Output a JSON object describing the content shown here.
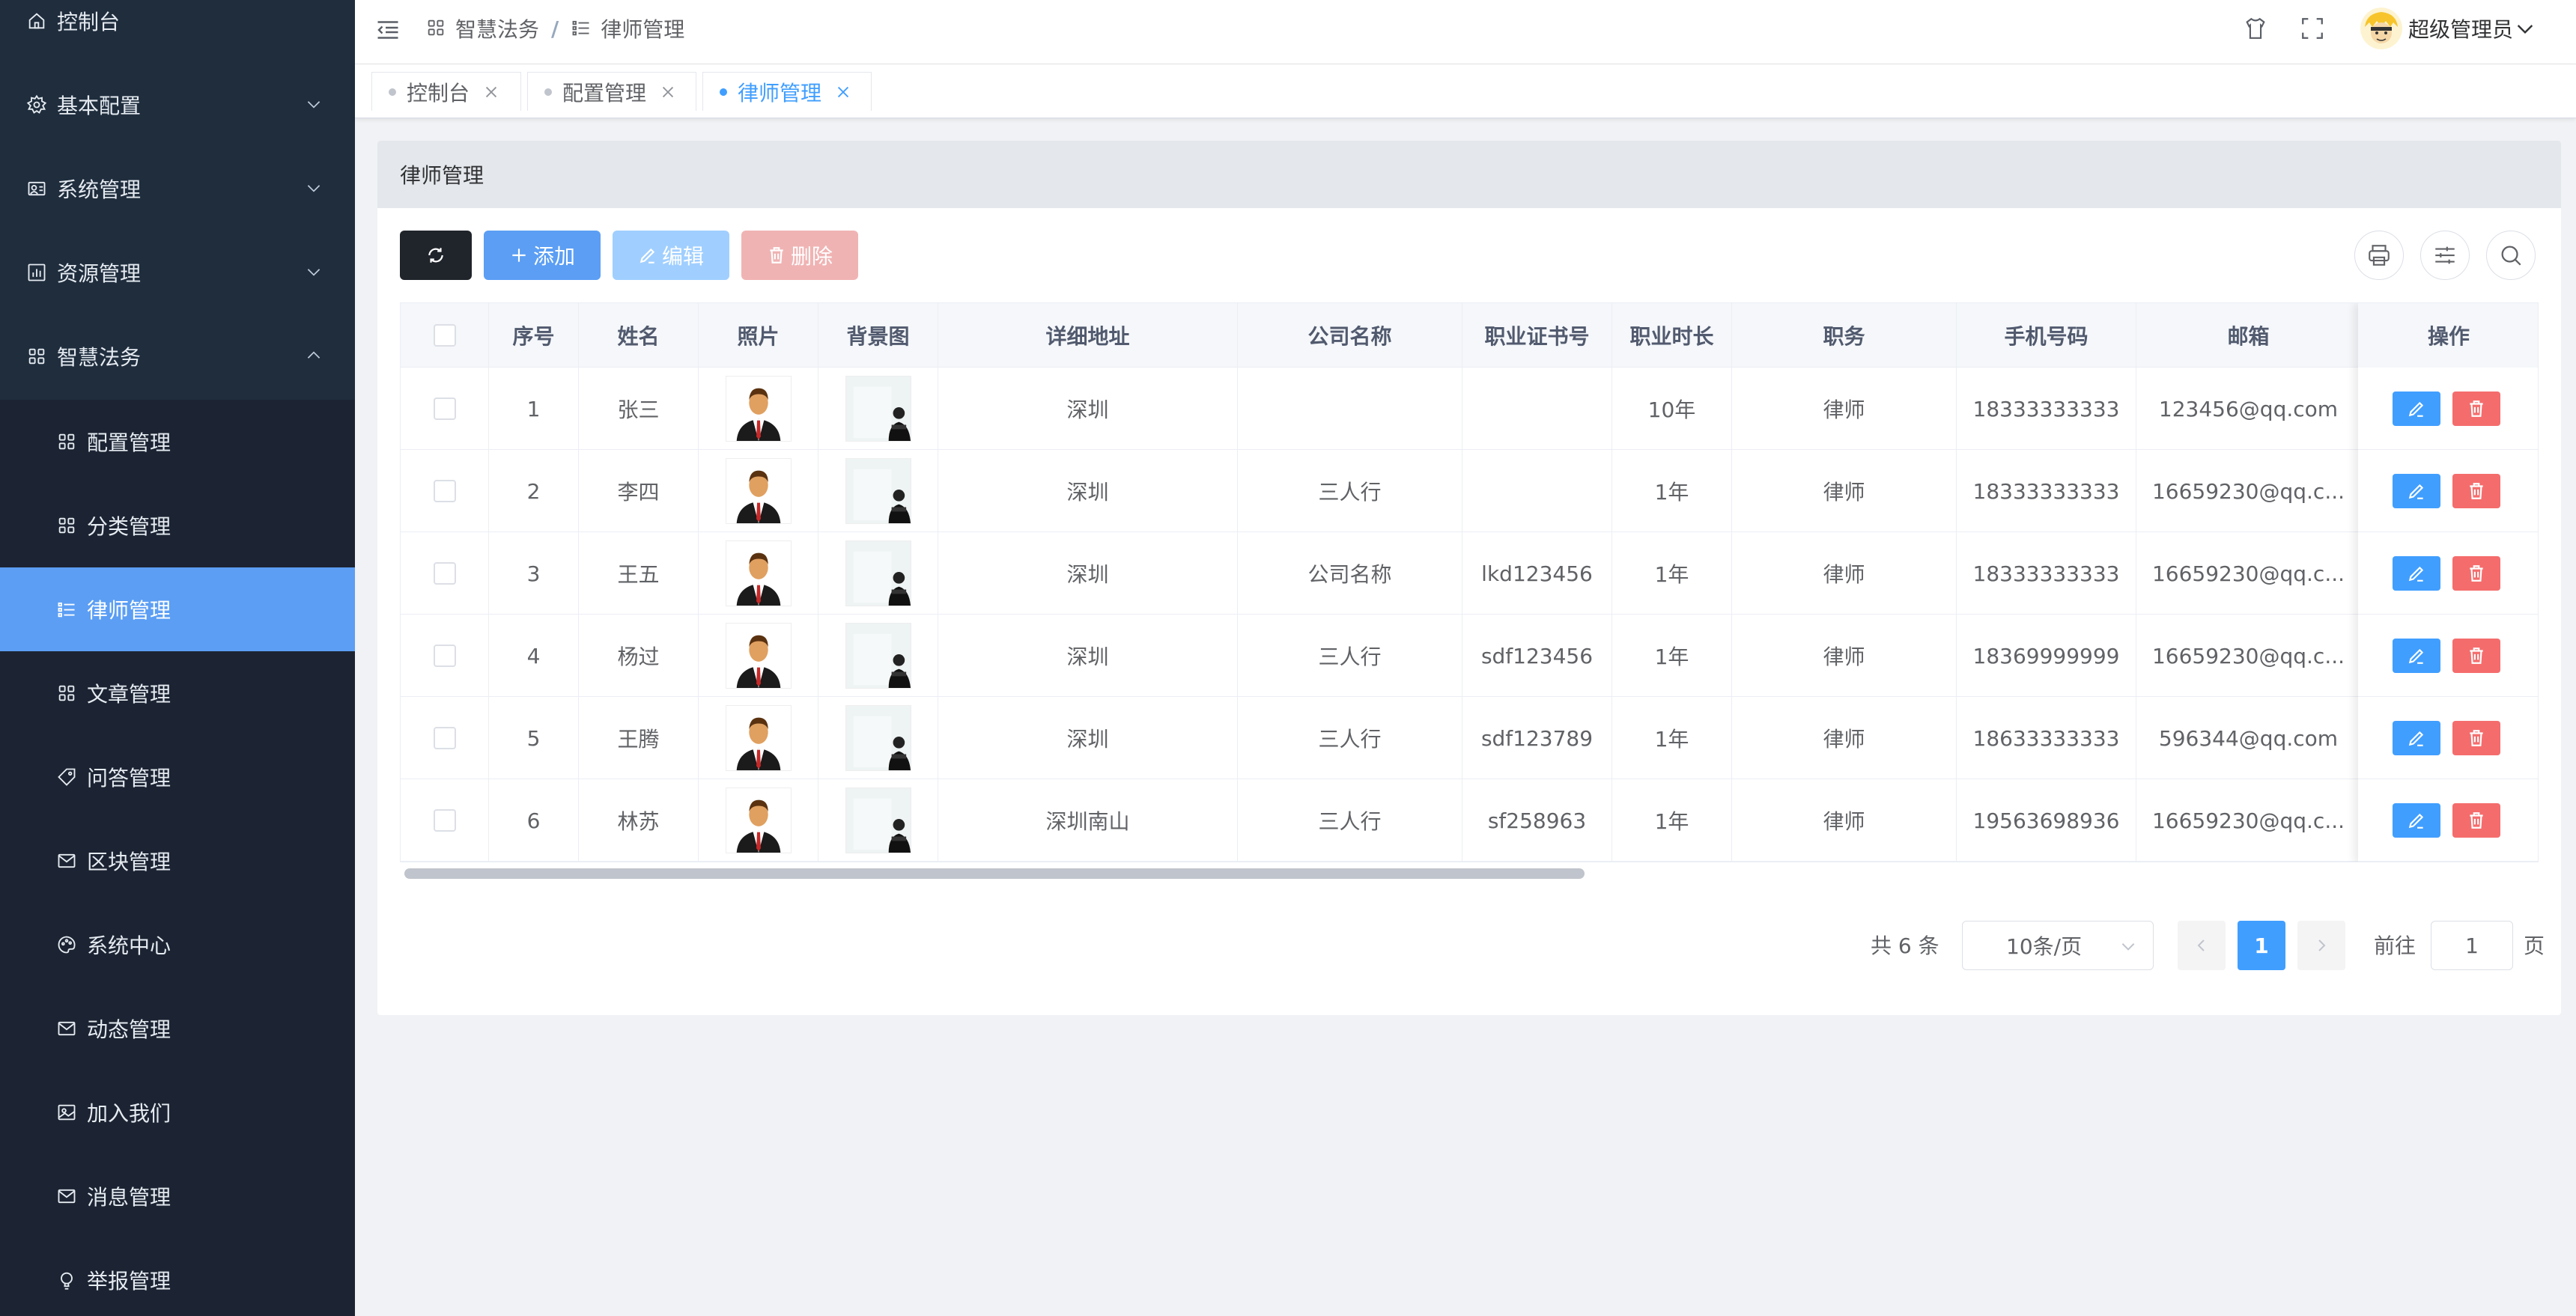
{
  "sidebar": {
    "items": [
      {
        "label": "控制台",
        "icon": "home-icon"
      },
      {
        "label": "基本配置",
        "icon": "gear-icon"
      },
      {
        "label": "系统管理",
        "icon": "user-card-icon"
      },
      {
        "label": "资源管理",
        "icon": "chart-icon"
      },
      {
        "label": "智慧法务",
        "icon": "grid-icon"
      }
    ],
    "subitems": [
      {
        "label": "配置管理",
        "icon": "grid-icon"
      },
      {
        "label": "分类管理",
        "icon": "grid-icon"
      },
      {
        "label": "律师管理",
        "icon": "list-icon"
      },
      {
        "label": "文章管理",
        "icon": "grid-icon"
      },
      {
        "label": "问答管理",
        "icon": "tag-icon"
      },
      {
        "label": "区块管理",
        "icon": "mail-icon"
      },
      {
        "label": "系统中心",
        "icon": "palette-icon"
      },
      {
        "label": "动态管理",
        "icon": "mail-icon"
      },
      {
        "label": "加入我们",
        "icon": "picture-icon"
      },
      {
        "label": "消息管理",
        "icon": "mail-icon"
      },
      {
        "label": "举报管理",
        "icon": "bulb-icon"
      }
    ],
    "active": "律师管理"
  },
  "header": {
    "breadcrumb": [
      "智慧法务",
      "律师管理"
    ],
    "username": "超级管理员"
  },
  "tags": [
    {
      "label": "控制台"
    },
    {
      "label": "配置管理"
    },
    {
      "label": "律师管理"
    }
  ],
  "card": {
    "title": "律师管理"
  },
  "toolbar": {
    "add": "添加",
    "edit": "编辑",
    "delete": "删除"
  },
  "table": {
    "columns": [
      "序号",
      "姓名",
      "照片",
      "背景图",
      "详细地址",
      "公司名称",
      "职业证书号",
      "职业时长",
      "职务",
      "手机号码",
      "邮箱",
      "操作"
    ],
    "rows": [
      {
        "idx": "1",
        "name": "张三",
        "address": "深圳",
        "company": "",
        "cert": "",
        "years": "10年",
        "title": "律师",
        "phone": "18333333333",
        "email": "123456@qq.com"
      },
      {
        "idx": "2",
        "name": "李四",
        "address": "深圳",
        "company": "三人行",
        "cert": "",
        "years": "1年",
        "title": "律师",
        "phone": "18333333333",
        "email": "16659230@qq.c..."
      },
      {
        "idx": "3",
        "name": "王五",
        "address": "深圳",
        "company": "公司名称",
        "cert": "lkd123456",
        "years": "1年",
        "title": "律师",
        "phone": "18333333333",
        "email": "16659230@qq.c..."
      },
      {
        "idx": "4",
        "name": "杨过",
        "address": "深圳",
        "company": "三人行",
        "cert": "sdf123456",
        "years": "1年",
        "title": "律师",
        "phone": "18369999999",
        "email": "16659230@qq.c..."
      },
      {
        "idx": "5",
        "name": "王腾",
        "address": "深圳",
        "company": "三人行",
        "cert": "sdf123789",
        "years": "1年",
        "title": "律师",
        "phone": "18633333333",
        "email": "596344@qq.com"
      },
      {
        "idx": "6",
        "name": "林苏",
        "address": "深圳南山",
        "company": "三人行",
        "cert": "sf258963",
        "years": "1年",
        "title": "律师",
        "phone": "19563698936",
        "email": "16659230@qq.c..."
      }
    ]
  },
  "pagination": {
    "total": "共 6 条",
    "page_size": "10条/页",
    "current": "1",
    "goto_label": "前往",
    "goto_value": "1",
    "page_suffix": "页"
  },
  "colors": {
    "sidebar_bg": "#1f2d3d",
    "active_menu": "#5b9ef4",
    "primary": "#409eff",
    "danger": "#f56c6c"
  }
}
